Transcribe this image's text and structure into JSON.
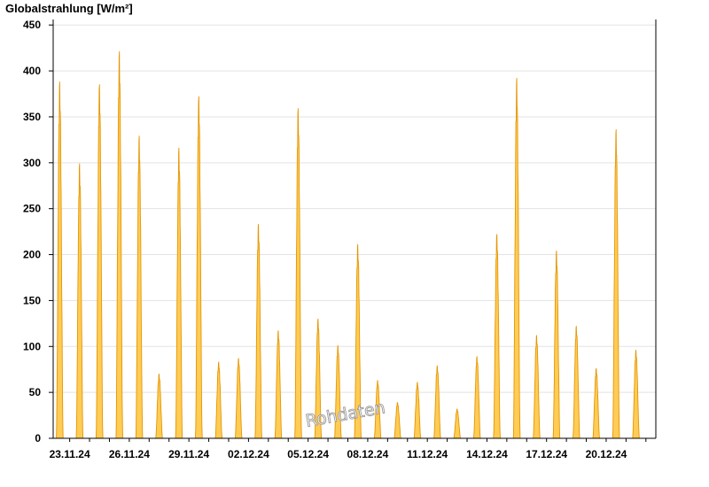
{
  "chart_data": {
    "type": "area",
    "title": "",
    "ylabel": "Globalstrahlung [W/m²]",
    "xlabel": "",
    "ylim": [
      0,
      460
    ],
    "yticks": [
      0,
      50,
      100,
      150,
      200,
      250,
      300,
      350,
      400,
      450
    ],
    "x_start": "22.11.24",
    "x_end": "22.12.24",
    "xticks": [
      "23.11.24",
      "26.11.24",
      "29.11.24",
      "02.12.24",
      "05.12.24",
      "08.12.24",
      "11.12.24",
      "14.12.24",
      "17.12.24",
      "20.12.24"
    ],
    "grid": true,
    "fill_color": "#FFCC55",
    "line_color": "#E69500",
    "watermark": "Rohdaten",
    "series": [
      {
        "values_per_day": [
          {
            "date": "22.11.24",
            "peak": 388
          },
          {
            "date": "23.11.24",
            "peak": 299
          },
          {
            "date": "24.11.24",
            "peak": 385
          },
          {
            "date": "25.11.24",
            "peak": 421
          },
          {
            "date": "26.11.24",
            "peak": 329
          },
          {
            "date": "27.11.24",
            "peak": 70
          },
          {
            "date": "28.11.24",
            "peak": 316
          },
          {
            "date": "29.11.24",
            "peak": 372
          },
          {
            "date": "30.11.24",
            "peak": 83
          },
          {
            "date": "01.12.24",
            "peak": 87
          },
          {
            "date": "02.12.24",
            "peak": 233
          },
          {
            "date": "03.12.24",
            "peak": 117
          },
          {
            "date": "04.12.24",
            "peak": 359
          },
          {
            "date": "05.12.24",
            "peak": 130
          },
          {
            "date": "06.12.24",
            "peak": 101
          },
          {
            "date": "07.12.24",
            "peak": 211
          },
          {
            "date": "08.12.24",
            "peak": 63
          },
          {
            "date": "09.12.24",
            "peak": 39
          },
          {
            "date": "10.12.24",
            "peak": 61
          },
          {
            "date": "11.12.24",
            "peak": 79
          },
          {
            "date": "12.12.24",
            "peak": 32
          },
          {
            "date": "13.12.24",
            "peak": 89
          },
          {
            "date": "14.12.24",
            "peak": 222
          },
          {
            "date": "15.12.24",
            "peak": 392
          },
          {
            "date": "16.12.24",
            "peak": 112
          },
          {
            "date": "17.12.24",
            "peak": 204
          },
          {
            "date": "18.12.24",
            "peak": 122
          },
          {
            "date": "19.12.24",
            "peak": 76
          },
          {
            "date": "20.12.24",
            "peak": 336
          },
          {
            "date": "21.12.24",
            "peak": 96
          }
        ]
      }
    ]
  }
}
